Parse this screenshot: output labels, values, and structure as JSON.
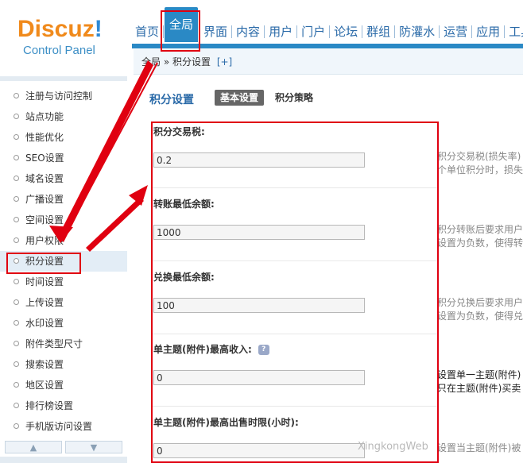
{
  "logo": {
    "brand": "Discuz",
    "excl": "!",
    "subtitle": "Control Panel"
  },
  "topnav": [
    {
      "label": "首页",
      "active": false
    },
    {
      "label": "全局",
      "active": true
    },
    {
      "label": "界面",
      "active": false
    },
    {
      "label": "内容",
      "active": false
    },
    {
      "label": "用户",
      "active": false
    },
    {
      "label": "门户",
      "active": false
    },
    {
      "label": "论坛",
      "active": false
    },
    {
      "label": "群组",
      "active": false
    },
    {
      "label": "防灌水",
      "active": false
    },
    {
      "label": "运营",
      "active": false
    },
    {
      "label": "应用",
      "active": false
    },
    {
      "label": "工具",
      "active": false
    }
  ],
  "breadcrumb": {
    "text": "全局 » 积分设置",
    "plus": "[+]"
  },
  "sidebar": {
    "items": [
      {
        "label": "注册与访问控制"
      },
      {
        "label": "站点功能"
      },
      {
        "label": "性能优化"
      },
      {
        "label": "SEO设置"
      },
      {
        "label": "域名设置"
      },
      {
        "label": "广播设置"
      },
      {
        "label": "空间设置"
      },
      {
        "label": "用户权限"
      },
      {
        "label": "积分设置",
        "active": true
      },
      {
        "label": "时间设置"
      },
      {
        "label": "上传设置"
      },
      {
        "label": "水印设置"
      },
      {
        "label": "附件类型尺寸"
      },
      {
        "label": "搜索设置"
      },
      {
        "label": "地区设置"
      },
      {
        "label": "排行榜设置"
      },
      {
        "label": "手机版访问设置"
      }
    ],
    "scroll_up": "▲",
    "scroll_down": "▼"
  },
  "main": {
    "title": "积分设置",
    "tabs": [
      {
        "label": "基本设置",
        "active": true
      },
      {
        "label": "积分策略",
        "active": false
      }
    ],
    "fields": [
      {
        "label": "积分交易税:",
        "value": "0.2",
        "desc": [
          "积分交易税(损失率)",
          "个单位积分时，损失"
        ]
      },
      {
        "label": "转账最低余额:",
        "value": "1000",
        "desc": [
          "积分转账后要求用户",
          "设置为负数，使得转"
        ]
      },
      {
        "label": "兑换最低余额:",
        "value": "100",
        "desc": [
          "积分兑换后要求用户",
          "设置为负数，使得兑"
        ]
      },
      {
        "label": "单主题(附件)最高收入:",
        "value": "0",
        "help_icon": "?",
        "desc": [
          "设置单一主题(附件)",
          "只在主题(附件)买卖"
        ]
      },
      {
        "label": "单主题(附件)最高出售时限(小时):",
        "value": "0",
        "desc": [
          "设置当主题(附件)被"
        ]
      }
    ]
  },
  "watermark": "XingkongWeb",
  "colors": {
    "accent": "#2a89c5",
    "annotation": "#e00010",
    "logo_orange": "#f08a1c"
  }
}
